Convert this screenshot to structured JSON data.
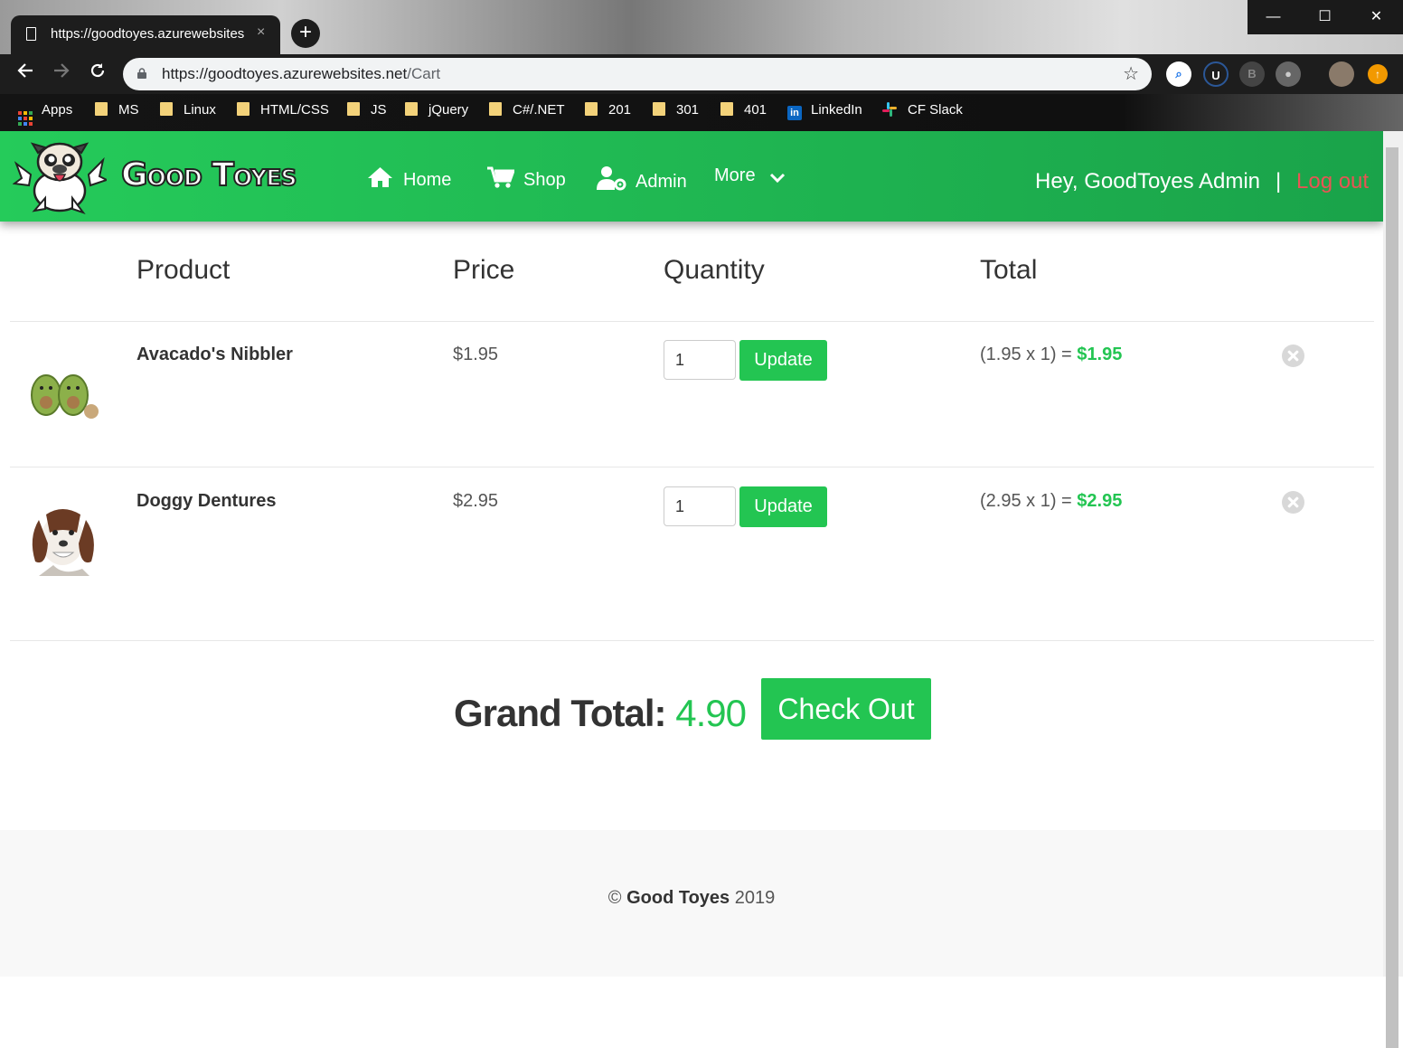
{
  "browser": {
    "tab_title": "https://goodtoyes.azurewebsites",
    "tab_close": "×",
    "new_tab": "+",
    "url_host": "https://goodtoyes.azurewebsites.net",
    "url_path": "/Cart",
    "window_controls": {
      "minimize": "—",
      "maximize": "☐",
      "close": "✕"
    },
    "bookmarks": [
      {
        "label": "Apps",
        "icon": "apps-grid-icon"
      },
      {
        "label": "MS",
        "icon": "folder-icon"
      },
      {
        "label": "Linux",
        "icon": "folder-icon"
      },
      {
        "label": "HTML/CSS",
        "icon": "folder-icon"
      },
      {
        "label": "JS",
        "icon": "folder-icon"
      },
      {
        "label": "jQuery",
        "icon": "folder-icon"
      },
      {
        "label": "C#/.NET",
        "icon": "folder-icon"
      },
      {
        "label": "201",
        "icon": "folder-icon"
      },
      {
        "label": "301",
        "icon": "folder-icon"
      },
      {
        "label": "401",
        "icon": "folder-icon"
      },
      {
        "label": "LinkedIn",
        "icon": "linkedin-icon"
      },
      {
        "label": "CF Slack",
        "icon": "slack-icon"
      }
    ]
  },
  "nav": {
    "brand": "Good Toyes",
    "links": [
      {
        "label": "Home",
        "icon": "home-icon"
      },
      {
        "label": "Shop",
        "icon": "cart-icon"
      },
      {
        "label": "Admin",
        "icon": "user-cog-icon"
      },
      {
        "label": "More",
        "icon": "chevron-down-icon"
      }
    ],
    "greeting": "Hey, GoodToyes Admin",
    "separator": "|",
    "logout": "Log out"
  },
  "cart": {
    "headers": {
      "product": "Product",
      "price": "Price",
      "quantity": "Quantity",
      "total": "Total"
    },
    "items": [
      {
        "name": "Avacado's Nibbler",
        "price": "$1.95",
        "quantity": "1",
        "update_label": "Update",
        "total_expr": "(1.95 x 1) =",
        "total": "$1.95"
      },
      {
        "name": "Doggy Dentures",
        "price": "$2.95",
        "quantity": "1",
        "update_label": "Update",
        "total_expr": "(2.95 x 1) =",
        "total": "$2.95"
      }
    ],
    "grand_total_label": "Grand Total:",
    "grand_total_value": "4.90",
    "checkout_label": "Check Out"
  },
  "footer": {
    "copyright": "©",
    "brand": "Good Toyes",
    "year": "2019"
  },
  "colors": {
    "accent": "#23c552",
    "logout": "#e85454",
    "navbar": "#25cb5a"
  }
}
